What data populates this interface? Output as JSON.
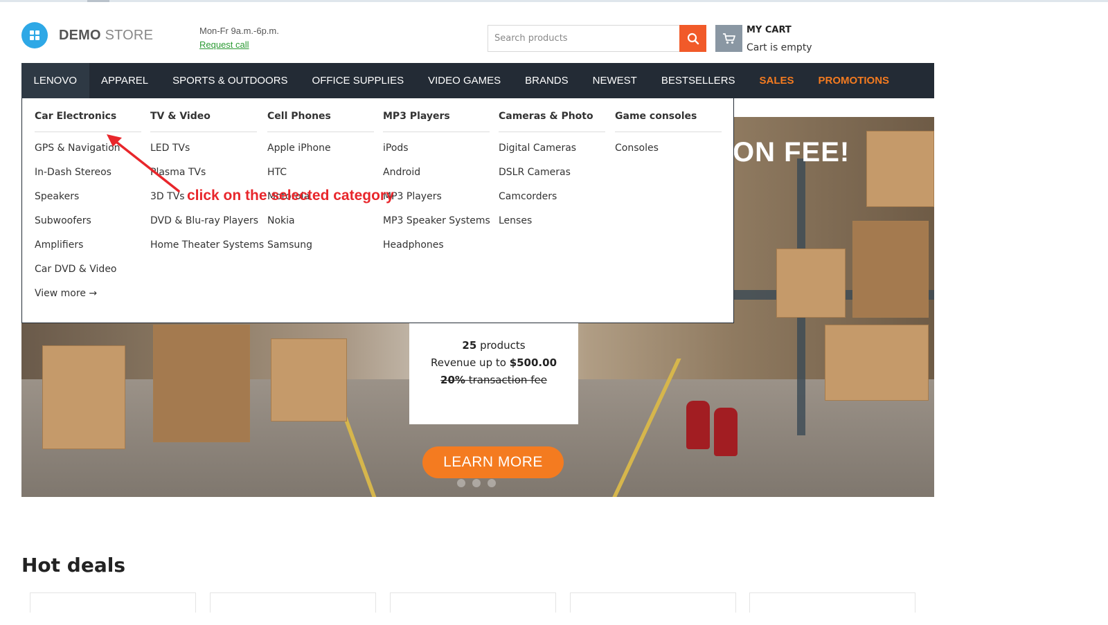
{
  "logo": {
    "brand": "DEMO",
    "suffix": "STORE"
  },
  "contact": {
    "hours": "Mon-Fr 9a.m.-6p.m.",
    "call_link": "Request call"
  },
  "search": {
    "placeholder": "Search products",
    "icon": "search-icon"
  },
  "cart": {
    "title": "MY CART",
    "status": "Cart is empty",
    "icon": "cart-icon"
  },
  "nav": {
    "items": [
      {
        "label": "LENOVO"
      },
      {
        "label": "APPAREL"
      },
      {
        "label": "SPORTS & OUTDOORS"
      },
      {
        "label": "OFFICE SUPPLIES"
      },
      {
        "label": "VIDEO GAMES"
      },
      {
        "label": "BRANDS"
      },
      {
        "label": "NEWEST"
      },
      {
        "label": "BESTSELLERS"
      },
      {
        "label": "SALES"
      },
      {
        "label": "PROMOTIONS"
      }
    ]
  },
  "dropdown": {
    "columns": [
      {
        "title": "Car Electronics",
        "items": [
          "GPS & Navigation",
          "In-Dash Stereos",
          "Speakers",
          "Subwoofers",
          "Amplifiers",
          "Car DVD & Video"
        ],
        "more": "View more →"
      },
      {
        "title": "TV & Video",
        "items": [
          "LED TVs",
          "Plasma TVs",
          "3D TVs",
          "DVD & Blu-ray Players",
          "Home Theater Systems"
        ]
      },
      {
        "title": "Cell Phones",
        "items": [
          "Apple iPhone",
          "HTC",
          "Motorola",
          "Nokia",
          "Samsung"
        ]
      },
      {
        "title": "MP3 Players",
        "items": [
          "iPods",
          "Android",
          "MP3 Players",
          "MP3 Speaker Systems",
          "Headphones"
        ]
      },
      {
        "title": "Cameras & Photo",
        "items": [
          "Digital Cameras",
          "DSLR Cameras",
          "Camcorders",
          "Lenses"
        ]
      },
      {
        "title": "Game consoles",
        "items": [
          "Consoles"
        ]
      }
    ]
  },
  "annotation": {
    "text": "click on the selected category"
  },
  "banner": {
    "headline": "ON FEE!",
    "products_count": "25",
    "products_label": " products",
    "revenue_label": "Revenue up to ",
    "revenue_value": "$500.00",
    "fee_percent": "20%",
    "fee_label": " transaction fee",
    "cta": "LEARN MORE"
  },
  "hot_deals": {
    "title": "Hot deals"
  },
  "colors": {
    "nav_bg": "#232b35",
    "accent": "#f47b20",
    "search_btn": "#f15a29",
    "logo": "#2ea8e6",
    "annotation": "#e8262b"
  }
}
